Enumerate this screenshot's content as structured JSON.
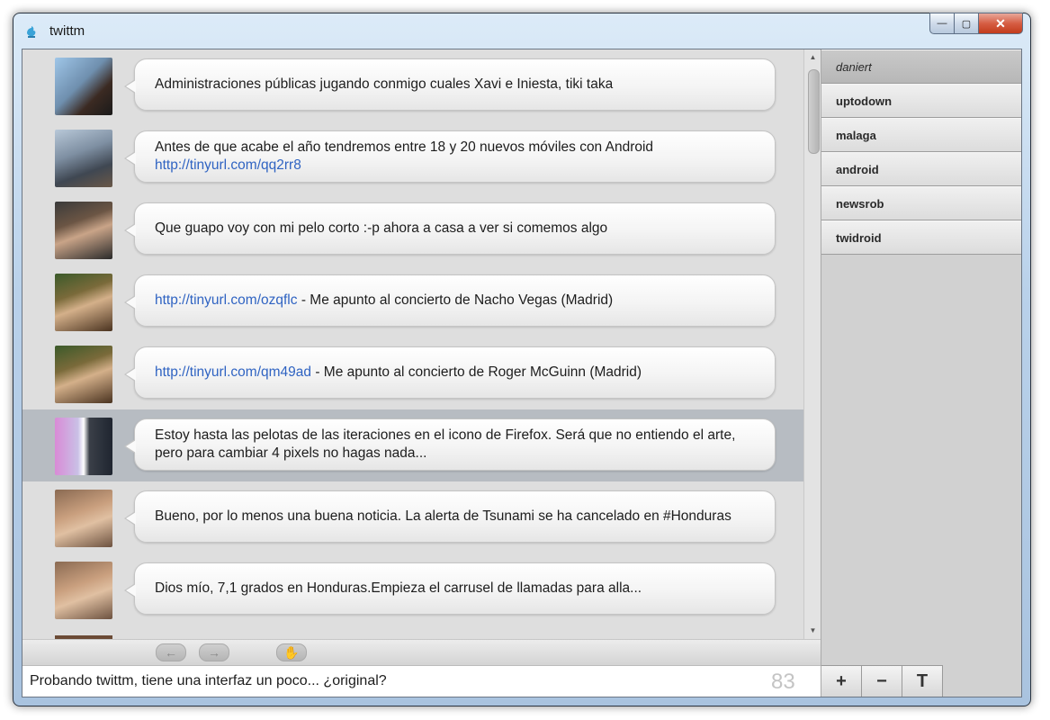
{
  "window": {
    "title": "twittm",
    "minimize": "—",
    "maximize": "▢",
    "close": "✕"
  },
  "tweets": [
    {
      "segments": [
        {
          "text": "Administraciones públicas jugando conmigo cuales Xavi e Iniesta, tiki taka",
          "link": false
        }
      ]
    },
    {
      "segments": [
        {
          "text": "Antes de que acabe el año tendremos entre 18 y 20 nuevos móviles con Android ",
          "link": false
        },
        {
          "text": "http://tinyurl.com/qq2rr8",
          "link": true
        }
      ]
    },
    {
      "segments": [
        {
          "text": "Que guapo voy con mi pelo corto :-p ahora a casa a ver si comemos algo",
          "link": false
        }
      ]
    },
    {
      "segments": [
        {
          "text": "http://tinyurl.com/ozqflc",
          "link": true
        },
        {
          "text": " - Me apunto al concierto de Nacho Vegas (Madrid)",
          "link": false
        }
      ]
    },
    {
      "segments": [
        {
          "text": "http://tinyurl.com/qm49ad",
          "link": true
        },
        {
          "text": " - Me apunto al concierto de Roger McGuinn (Madrid)",
          "link": false
        }
      ]
    },
    {
      "selected": true,
      "segments": [
        {
          "text": "Estoy hasta las pelotas de las iteraciones en el icono de Firefox. Será que no entiendo el arte, pero para cambiar 4 pixels no hagas nada...",
          "link": false
        }
      ]
    },
    {
      "segments": [
        {
          "text": "Bueno, por lo menos una buena noticia. La alerta de Tsunami se ha cancelado en #Honduras",
          "link": false
        }
      ]
    },
    {
      "segments": [
        {
          "text": "Dios mío, 7,1 grados en Honduras.Empieza el carrusel de llamadas para alla...",
          "link": false
        }
      ]
    }
  ],
  "toolbar": {
    "back": "←",
    "forward": "→",
    "hand": "✋"
  },
  "compose": {
    "value": "Probando twittm, tiene una interfaz un poco... ¿original?",
    "remaining": "83"
  },
  "accounts": [
    {
      "name": "daniert",
      "active": true
    },
    {
      "name": "uptodown",
      "active": false
    },
    {
      "name": "malaga",
      "active": false
    },
    {
      "name": "android",
      "active": false
    },
    {
      "name": "newsrob",
      "active": false
    },
    {
      "name": "twidroid",
      "active": false
    }
  ],
  "side_buttons": {
    "add": "+",
    "remove": "−",
    "text": "T"
  },
  "scrollbar": {
    "up": "▲",
    "down": "▼"
  }
}
